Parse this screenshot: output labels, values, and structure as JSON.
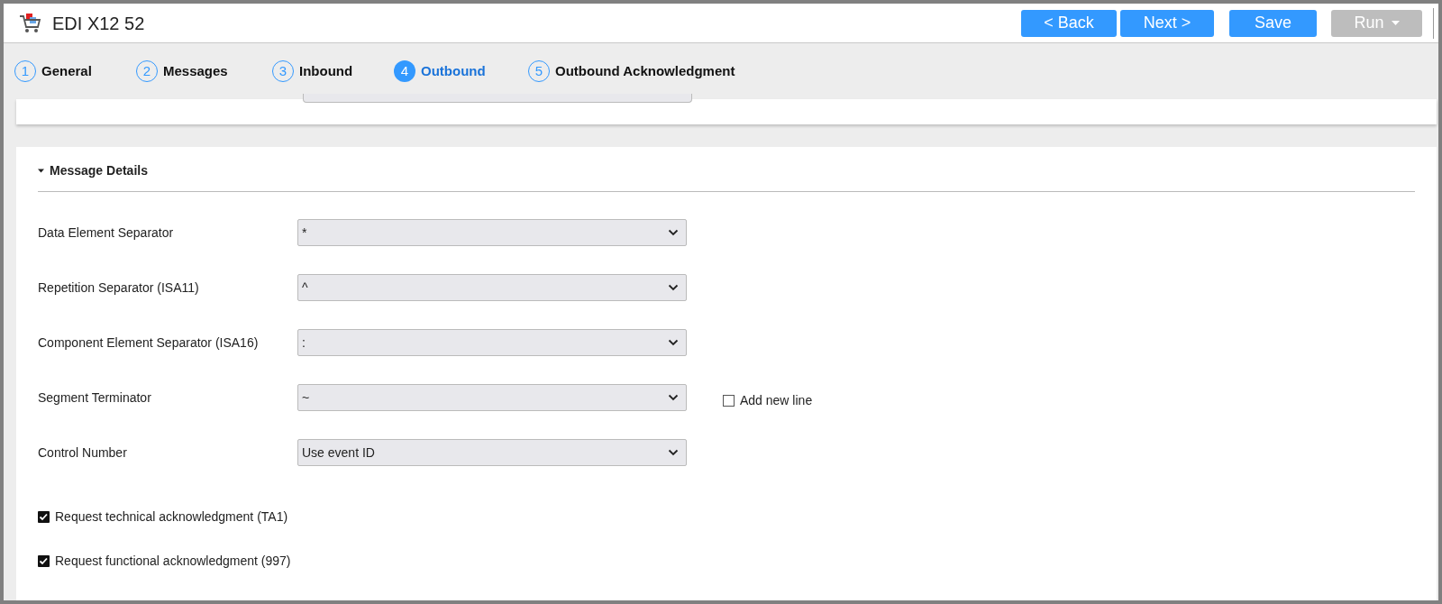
{
  "window": {
    "title": "EDI X12 52"
  },
  "buttons": [
    {
      "label": "< Back",
      "disabled": false
    },
    {
      "label": "Next >",
      "disabled": false
    },
    {
      "label": "Save",
      "disabled": false
    },
    {
      "label": "Run",
      "disabled": true,
      "dropdown": true
    }
  ],
  "steps": [
    {
      "number": "1",
      "label": "General",
      "selected": false
    },
    {
      "number": "2",
      "label": "Messages",
      "selected": false
    },
    {
      "number": "3",
      "label": "Inbound",
      "selected": false
    },
    {
      "number": "4",
      "label": "Outbound",
      "selected": true
    },
    {
      "number": "5",
      "label": "Outbound Acknowledgment",
      "selected": false
    }
  ],
  "section": {
    "title": "Message Details",
    "expanded": true,
    "fields": [
      {
        "label": "Data Element Separator",
        "value": "*"
      },
      {
        "label": "Repetition Separator (ISA11)",
        "value": "^"
      },
      {
        "label": "Component Element Separator (ISA16)",
        "value": ":"
      },
      {
        "label": "Segment Terminator",
        "value": "~",
        "option": {
          "label": "Add new line",
          "checked": false
        }
      },
      {
        "label": "Control Number",
        "value": "Use event ID"
      }
    ],
    "checkboxes": [
      {
        "label": "Request technical acknowledgment (TA1)",
        "checked": true
      },
      {
        "label": "Request functional acknowledgment (997)",
        "checked": true
      }
    ]
  }
}
